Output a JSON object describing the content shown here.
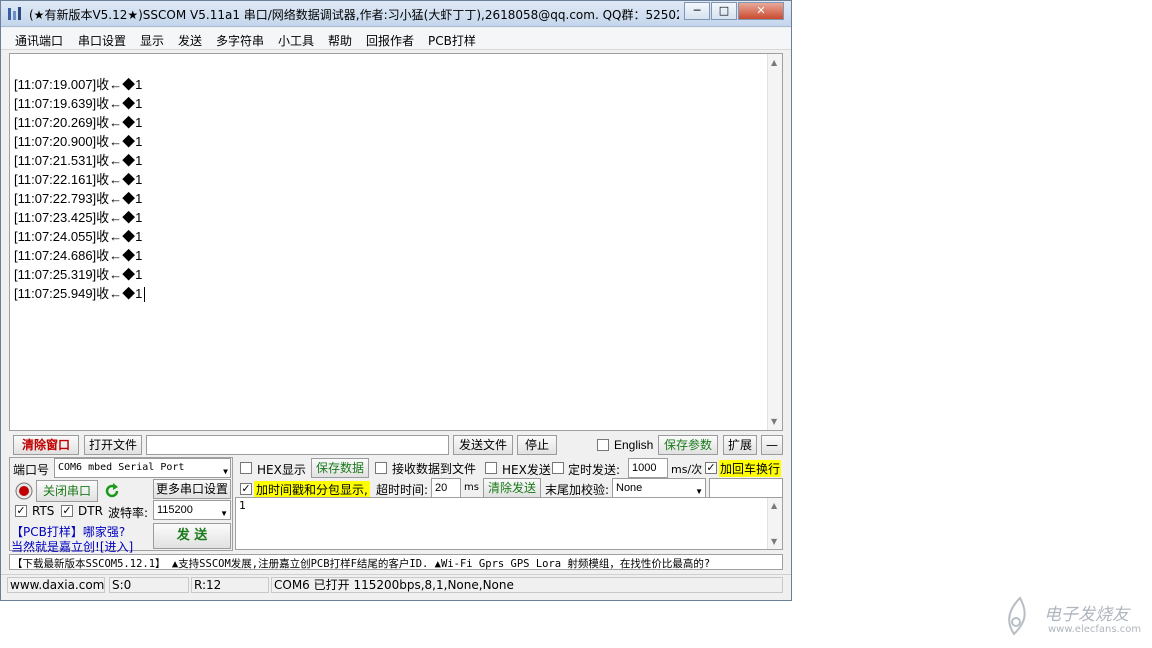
{
  "window": {
    "title": "(★有新版本V5.12★)SSCOM V5.11a1 串口/网络数据调试器,作者:习小猛(大虾丁丁),2618058@qq.com. QQ群：52502...",
    "minimize": "─",
    "maximize": "□",
    "close": "✕"
  },
  "menu": [
    "通讯端口",
    "串口设置",
    "显示",
    "发送",
    "多字符串",
    "小工具",
    "帮助",
    "回报作者",
    "PCB打样"
  ],
  "receive": {
    "lines": [
      "[11:07:19.007]收←◆1",
      "[11:07:19.639]收←◆1",
      "[11:07:20.269]收←◆1",
      "[11:07:20.900]收←◆1",
      "[11:07:21.531]收←◆1",
      "[11:07:22.161]收←◆1",
      "[11:07:22.793]收←◆1",
      "[11:07:23.425]收←◆1",
      "[11:07:24.055]收←◆1",
      "[11:07:24.686]收←◆1",
      "[11:07:25.319]收←◆1",
      "[11:07:25.949]收←◆1"
    ]
  },
  "toolbar": {
    "clear_window": "清除窗口",
    "open_file": "打开文件",
    "file_path": "",
    "send_file": "发送文件",
    "stop": "停止",
    "english": "English",
    "save_params": "保存参数",
    "expand": "扩展",
    "collapse": "—"
  },
  "port": {
    "port_label": "端口号",
    "port_value": "COM6 mbed Serial Port",
    "close_port": "关闭串口",
    "more_settings": "更多串口设置",
    "rts": "RTS",
    "dtr": "DTR",
    "rts_checked": true,
    "dtr_checked": true,
    "baud_label": "波特率:",
    "baud_value": "115200",
    "ad_line1": "【PCB打样】哪家强?",
    "ad_line2": "当然就是嘉立创!",
    "ad_link": "[进入]",
    "send": "发  送"
  },
  "options": {
    "hex_display": "HEX显示",
    "hex_display_checked": false,
    "save_data": "保存数据",
    "recv_to_file": "接收数据到文件",
    "recv_to_file_checked": false,
    "hex_send": "HEX发送",
    "hex_send_checked": false,
    "timed_send": "定时发送:",
    "timed_send_checked": false,
    "interval": "1000",
    "interval_unit": "ms/次",
    "add_crlf": "加回车换行",
    "add_crlf_checked": true,
    "timestamp": "加时间戳和分包显示,",
    "timestamp_checked": true,
    "timeout_label": "超时时间:",
    "timeout_value": "20",
    "timeout_unit": "ms",
    "clear_send": "清除发送",
    "checksum_label": "末尾加校验:",
    "checksum_value": "None"
  },
  "send_area": {
    "text": "1"
  },
  "banner": "【下载最新版本SSCOM5.12.1】 ▲支持SSCOM发展,注册嘉立创PCB打样F结尾的客户ID. ▲Wi-Fi Gprs GPS Lora 射频模组，在找性价比最高的?",
  "status": {
    "website": "www.daxia.com",
    "sent": "S:0",
    "received": "R:12",
    "port_status": "COM6 已打开  115200bps,8,1,None,None"
  },
  "watermark": {
    "line1": "电子发烧友",
    "line2": "www.elecfans.com"
  },
  "colors": {
    "highlight_yellow": "#ffff00",
    "save_green": "#1a7a1a",
    "clear_red": "#c00000"
  }
}
